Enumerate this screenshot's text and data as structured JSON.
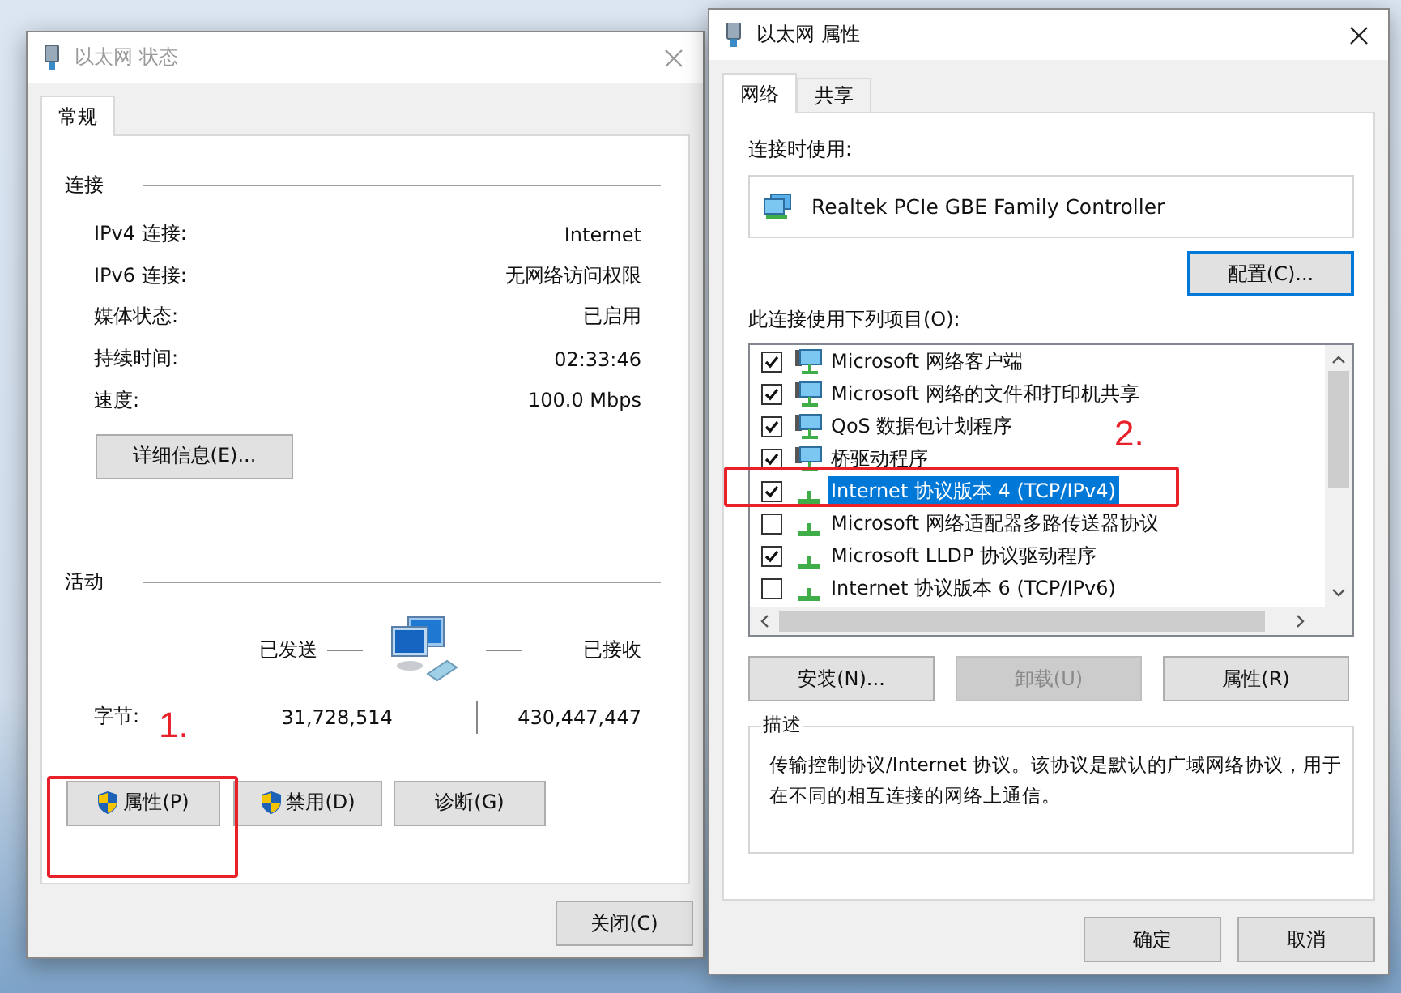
{
  "status_window": {
    "title": "以太网 状态",
    "tabs": [
      {
        "label": "常规",
        "selected": true
      }
    ],
    "connection": {
      "heading": "连接",
      "rows": [
        {
          "label": "IPv4 连接:",
          "value": "Internet"
        },
        {
          "label": "IPv6 连接:",
          "value": "无网络访问权限"
        },
        {
          "label": "媒体状态:",
          "value": "已启用"
        },
        {
          "label": "持续时间:",
          "value": "02:33:46"
        },
        {
          "label": "速度:",
          "value": "100.0 Mbps"
        }
      ]
    },
    "details_button": "详细信息(E)...",
    "activity": {
      "heading": "活动",
      "sent_label": "已发送",
      "received_label": "已接收",
      "bytes_label": "字节:",
      "sent": "31,728,514",
      "received": "430,447,447"
    },
    "buttons": [
      {
        "label": "属性(P)",
        "shield": true
      },
      {
        "label": "禁用(D)",
        "shield": true
      },
      {
        "label": "诊断(G)",
        "shield": false
      }
    ],
    "close_button": "关闭(C)"
  },
  "properties_window": {
    "title": "以太网 属性",
    "tabs": [
      {
        "label": "网络",
        "selected": true
      },
      {
        "label": "共享",
        "selected": false
      }
    ],
    "connect_using_label": "连接时使用:",
    "adapter": "Realtek PCIe GBE Family Controller",
    "configure_button": "配置(C)...",
    "items_label": "此连接使用下列项目(O):",
    "items": [
      {
        "label": "Microsoft 网络客户端",
        "checked": true,
        "selected": false,
        "kind": "service"
      },
      {
        "label": "Microsoft 网络的文件和打印机共享",
        "checked": true,
        "selected": false,
        "kind": "service"
      },
      {
        "label": "QoS 数据包计划程序",
        "checked": true,
        "selected": false,
        "kind": "service"
      },
      {
        "label": "桥驱动程序",
        "checked": true,
        "selected": false,
        "kind": "service"
      },
      {
        "label": "Internet 协议版本 4 (TCP/IPv4)",
        "checked": true,
        "selected": true,
        "kind": "protocol"
      },
      {
        "label": "Microsoft 网络适配器多路传送器协议",
        "checked": false,
        "selected": false,
        "kind": "protocol"
      },
      {
        "label": "Microsoft LLDP 协议驱动程序",
        "checked": true,
        "selected": false,
        "kind": "protocol"
      },
      {
        "label": "Internet 协议版本 6 (TCP/IPv6)",
        "checked": false,
        "selected": false,
        "kind": "protocol"
      }
    ],
    "item_buttons": [
      {
        "label": "安装(N)...",
        "disabled": false
      },
      {
        "label": "卸载(U)",
        "disabled": true
      },
      {
        "label": "属性(R)",
        "disabled": false
      }
    ],
    "description": {
      "heading": "描述",
      "text": "传输控制协议/Internet 协议。该协议是默认的广域网络协议，用于在不同的相互连接的网络上通信。"
    },
    "buttons": [
      "确定",
      "取消"
    ]
  },
  "annotations": [
    {
      "label": "1."
    },
    {
      "label": "2."
    }
  ]
}
